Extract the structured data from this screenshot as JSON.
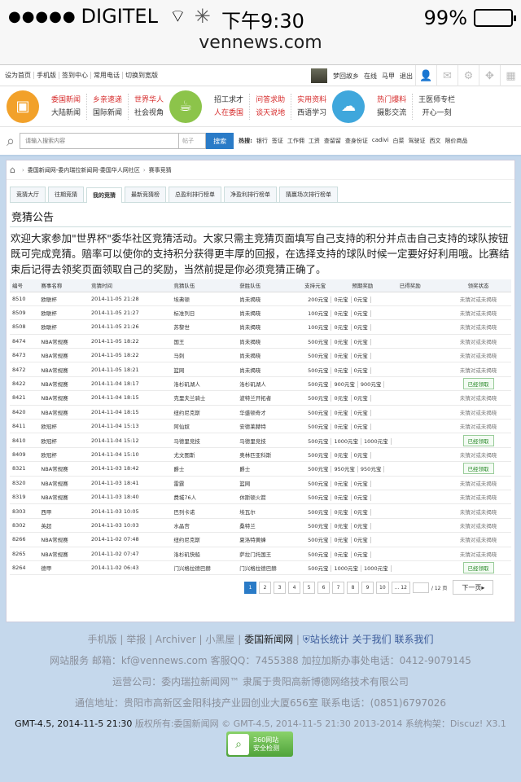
{
  "status": {
    "carrier": "DIGITEL",
    "time": "下午9:30",
    "battery": "99%"
  },
  "browser": {
    "url": "vennews.com"
  },
  "topnav": {
    "links": [
      "设为首页",
      "手机版",
      "签到中心",
      "常用电话",
      "切换到宽版"
    ],
    "user_links": [
      "梦回故乡",
      "在线",
      "马甲",
      "退出"
    ]
  },
  "categories": [
    {
      "a": "委国新闻",
      "b": "大陆新闻",
      "a_red": true
    },
    {
      "a": "乡亲速递",
      "b": "国际新闻",
      "a_red": true
    },
    {
      "a": "世界华人",
      "b": "社会视角",
      "a_red": true
    },
    {
      "a": "招工求才",
      "b": "人在委国",
      "b_red": true
    },
    {
      "a": "问答求助",
      "b": "谈天说地",
      "both_red": true
    },
    {
      "a": "实用资料",
      "b": "西语学习",
      "a_red": true
    },
    {
      "a": "热门爆料",
      "b": "摄影交流",
      "a_red": true
    },
    {
      "a": "王医师专栏",
      "b": "开心一刻"
    }
  ],
  "search": {
    "placeholder": "请输入搜索内容",
    "type": "帖子",
    "button": "搜索",
    "hot_label": "热搜:",
    "hot": [
      "银行",
      "签证",
      "工作佣",
      "工资",
      "查留留",
      "查身份证",
      "cadivi",
      "白菜",
      "驾驶证",
      "西文",
      "限价商品"
    ]
  },
  "breadcrumb": [
    "委国新闻网-委内瑞拉新闻网-委国华人网社区",
    "赛事竞猜"
  ],
  "tabs": [
    "竞猜大厅",
    "往期竞猜",
    "我的竞猜",
    "最新竞猜榜",
    "总盈利排行榜单",
    "净盈利排行榜单",
    "猜赢场次排行榜单"
  ],
  "active_tab": 2,
  "notice": {
    "title": "竞猜公告",
    "text": "欢迎大家参加\"世界杯\"委华社区竞猜活动。大家只需主竞猜页面填写自己支持的积分并点击自己支持的球队按钮既可完成竞猜。赔率可以使你的支持积分获得更丰厚的回报，在选择支持的球队时候一定要好好利用哦。比赛结束后记得去领奖页面领取自己的奖励，当然前提是你必须竞猜正确了。"
  },
  "table": {
    "headers": [
      "编号",
      "赛事名称",
      "竞猜时间",
      "竞猜队伍",
      "获胜队伍",
      "支持元宝",
      "预期奖励",
      "已得奖励",
      "领奖状态"
    ],
    "rows": [
      [
        "8510",
        "欧联杯",
        "2014-11-05 21:28",
        "埃弗顿",
        "尚未揭晓",
        "200元宝",
        "0元宝",
        "0元宝",
        "未猜对或未揭晓"
      ],
      [
        "8509",
        "欧联杯",
        "2014-11-05 21:27",
        "标准列日",
        "尚未揭晓",
        "100元宝",
        "0元宝",
        "0元宝",
        "未猜对或未揭晓"
      ],
      [
        "8508",
        "欧联杯",
        "2014-11-05 21:26",
        "苏黎世",
        "尚未揭晓",
        "100元宝",
        "0元宝",
        "0元宝",
        "未猜对或未揭晓"
      ],
      [
        "8474",
        "NBA常规赛",
        "2014-11-05 18:22",
        "国王",
        "尚未揭晓",
        "500元宝",
        "0元宝",
        "0元宝",
        "未猜对或未揭晓"
      ],
      [
        "8473",
        "NBA常规赛",
        "2014-11-05 18:22",
        "马刺",
        "尚未揭晓",
        "500元宝",
        "0元宝",
        "0元宝",
        "未猜对或未揭晓"
      ],
      [
        "8472",
        "NBA常规赛",
        "2014-11-05 18:21",
        "篮网",
        "尚未揭晓",
        "500元宝",
        "0元宝",
        "0元宝",
        "未猜对或未揭晓"
      ],
      [
        "8422",
        "NBA常规赛",
        "2014-11-04 18:17",
        "洛杉矶湖人",
        "洛杉矶湖人",
        "500元宝",
        "900元宝",
        "900元宝",
        "已经领取"
      ],
      [
        "8421",
        "NBA常规赛",
        "2014-11-04 18:15",
        "克里夫兰骑士",
        "波特兰开拓者",
        "500元宝",
        "0元宝",
        "0元宝",
        "未猜对或未揭晓"
      ],
      [
        "8420",
        "NBA常规赛",
        "2014-11-04 18:15",
        "纽约尼克斯",
        "华盛顿奇才",
        "500元宝",
        "0元宝",
        "0元宝",
        "未猜对或未揭晓"
      ],
      [
        "8411",
        "欧冠杯",
        "2014-11-04 15:13",
        "阿仙奴",
        "安德莱赫特",
        "500元宝",
        "0元宝",
        "0元宝",
        "未猜对或未揭晓"
      ],
      [
        "8410",
        "欧冠杯",
        "2014-11-04 15:12",
        "马德里竞技",
        "马德里竞技",
        "500元宝",
        "1000元宝",
        "1000元宝",
        "已经领取"
      ],
      [
        "8409",
        "欧冠杯",
        "2014-11-04 15:10",
        "尤文图斯",
        "奥林匹亚科斯",
        "500元宝",
        "0元宝",
        "0元宝",
        "未猜对或未揭晓"
      ],
      [
        "8321",
        "NBA常规赛",
        "2014-11-03 18:42",
        "爵士",
        "爵士",
        "500元宝",
        "950元宝",
        "950元宝",
        "已经领取"
      ],
      [
        "8320",
        "NBA常规赛",
        "2014-11-03 18:41",
        "雷霆",
        "篮网",
        "500元宝",
        "0元宝",
        "0元宝",
        "未猜对或未揭晓"
      ],
      [
        "8319",
        "NBA常规赛",
        "2014-11-03 18:40",
        "费城76人",
        "休斯顿火箭",
        "500元宝",
        "0元宝",
        "0元宝",
        "未猜对或未揭晓"
      ],
      [
        "8303",
        "西甲",
        "2014-11-03 10:05",
        "巴列卡诺",
        "埃瓦尔",
        "500元宝",
        "0元宝",
        "0元宝",
        "未猜对或未揭晓"
      ],
      [
        "8302",
        "英超",
        "2014-11-03 10:03",
        "水晶宫",
        "桑特兰",
        "500元宝",
        "0元宝",
        "0元宝",
        "未猜对或未揭晓"
      ],
      [
        "8266",
        "NBA常规赛",
        "2014-11-02 07:48",
        "纽约尼克斯",
        "夏洛特黄蜂",
        "500元宝",
        "0元宝",
        "0元宝",
        "未猜对或未揭晓"
      ],
      [
        "8265",
        "NBA常规赛",
        "2014-11-02 07:47",
        "洛杉矶快船",
        "萨拉门托国王",
        "500元宝",
        "0元宝",
        "0元宝",
        "未猜对或未揭晓"
      ],
      [
        "8264",
        "德甲",
        "2014-11-02 06:43",
        "门兴格拉德巴赫",
        "门兴格拉德巴赫",
        "500元宝",
        "1000元宝",
        "1000元宝",
        "已经领取"
      ]
    ]
  },
  "pager": {
    "pages": [
      "1",
      "2",
      "3",
      "4",
      "5",
      "6",
      "7",
      "8",
      "9",
      "10",
      "... 12"
    ],
    "current": 1,
    "total": "/ 12 页",
    "next": "下一页"
  },
  "footer": {
    "row1": [
      "手机版",
      "举报",
      "Archiver",
      "小黑屋",
      "委国新闻网",
      "站长统计",
      "关于我们",
      "联系我们"
    ],
    "row2": "网站服务 邮箱：kf@vennews.com 客服QQ：7455388 加拉加斯办事处电话：0412-9079145",
    "row3": "运营公司：委内瑞拉新闻网™ 隶属于贵阳高新博德网络技术有限公司",
    "row4": "通信地址：贵阳市高新区金阳科技产业园创业大厦656室 联系电话：(0851)6797026",
    "row5_dark": "GMT-4.5, 2014-11-5 21:30",
    "row5_rest": "版权所有:委国新闻网 © GMT-4.5, 2014-11-5 21:30 2013-2014 系统构架：Discuz! X3.1",
    "badge_top": "360网站",
    "badge_bottom": "安全检测"
  },
  "colors": {
    "accent": "#2a7bc7",
    "red": "#d62b2b",
    "bg": "#c5d8ec"
  }
}
